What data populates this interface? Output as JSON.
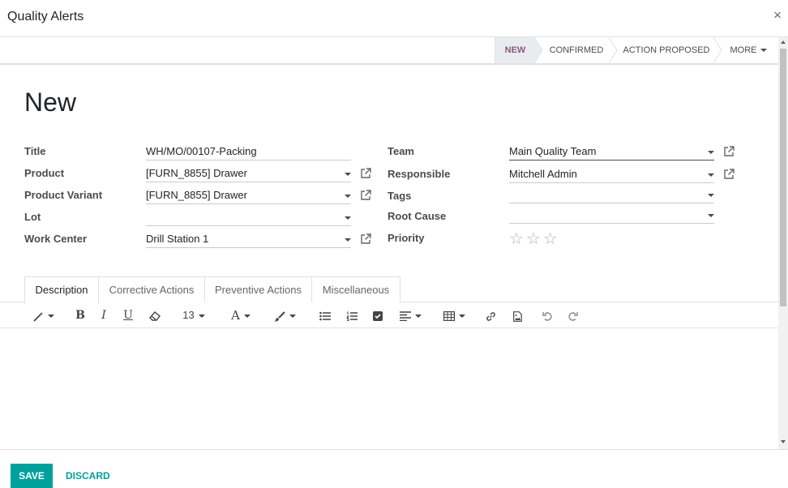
{
  "modal": {
    "title": "Quality Alerts",
    "close_symbol": "×"
  },
  "statusbar": {
    "stages": [
      {
        "label": "NEW",
        "active": true
      },
      {
        "label": "CONFIRMED",
        "active": false
      },
      {
        "label": "ACTION PROPOSED",
        "active": false
      }
    ],
    "more_label": "MORE"
  },
  "record": {
    "name": "New"
  },
  "fields_left": [
    {
      "label": "Title",
      "value": "WH/MO/00107-Packing"
    },
    {
      "label": "Product",
      "value": "[FURN_8855] Drawer"
    },
    {
      "label": "Product Variant",
      "value": "[FURN_8855] Drawer"
    },
    {
      "label": "Lot",
      "value": ""
    },
    {
      "label": "Work Center",
      "value": "Drill Station 1"
    }
  ],
  "fields_right": [
    {
      "label": "Team",
      "value": "Main Quality Team"
    },
    {
      "label": "Responsible",
      "value": "Mitchell Admin"
    },
    {
      "label": "Tags",
      "value": ""
    },
    {
      "label": "Root Cause",
      "value": ""
    },
    {
      "label": "Priority",
      "value": ""
    }
  ],
  "priority": {
    "stars": 3,
    "selected": 0,
    "symbol": "☆"
  },
  "tabs": [
    {
      "label": "Description",
      "active": true
    },
    {
      "label": "Corrective Actions",
      "active": false
    },
    {
      "label": "Preventive Actions",
      "active": false
    },
    {
      "label": "Miscellaneous",
      "active": false
    }
  ],
  "editor": {
    "font_size": "13",
    "toolbar_icons": [
      "magic-wand-icon",
      "bold-icon",
      "italic-icon",
      "underline-icon",
      "eraser-icon",
      "font-size-dropdown",
      "font-color-icon",
      "paint-brush-icon",
      "unordered-list-icon",
      "ordered-list-icon",
      "checklist-icon",
      "align-icon",
      "table-icon",
      "link-icon",
      "image-icon",
      "undo-icon",
      "redo-icon"
    ],
    "content": ""
  },
  "footer": {
    "save_label": "SAVE",
    "discard_label": "DISCARD"
  },
  "colors": {
    "primary": "#00a09d",
    "stage_active": "#875a7b",
    "star": "#adb5bd"
  }
}
